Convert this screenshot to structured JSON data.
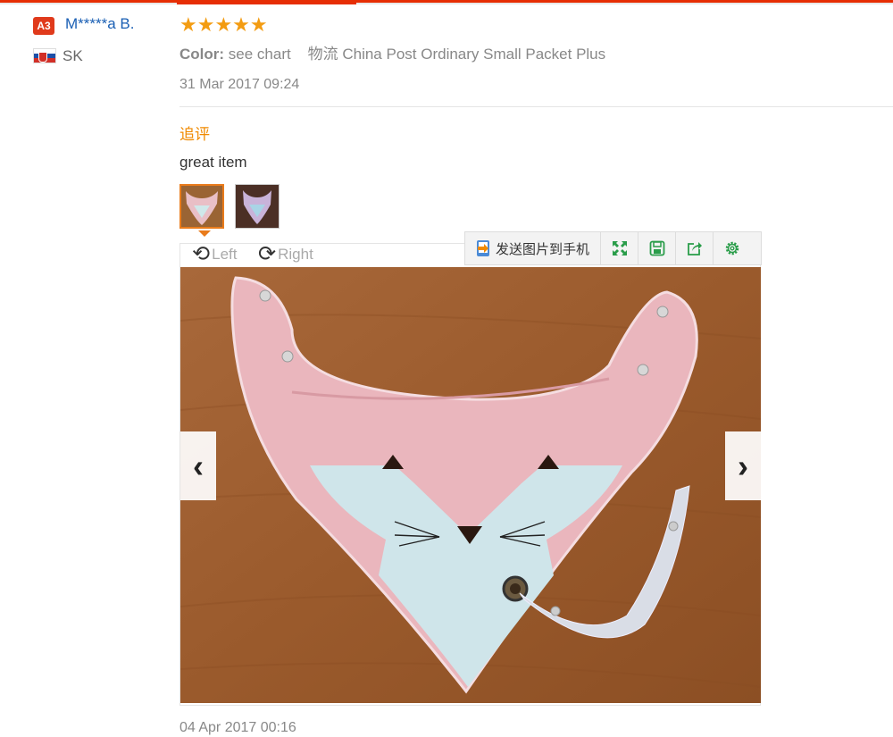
{
  "reviewer": {
    "badge": "A3",
    "name": "M*****a B.",
    "country": "SK"
  },
  "review": {
    "stars": "★★★★★",
    "color_label": "Color:",
    "color_value": "see chart",
    "shipping": "物流 China Post Ordinary Small Packet Plus",
    "date": "31 Mar 2017 09:24",
    "followup_label": "追评",
    "followup_text": "great item",
    "followup_date": "04 Apr 2017 00:16"
  },
  "viewer": {
    "rotate_left": "Left",
    "rotate_right": "Right",
    "send_to_phone": "发送图片到手机",
    "prev": "‹",
    "next": "›"
  },
  "icons": [
    "rotate-left-icon",
    "rotate-right-icon",
    "send-to-phone-icon",
    "fullscreen-icon",
    "save-icon",
    "share-icon",
    "settings-icon"
  ],
  "colors": {
    "accent": "#e62e04",
    "star": "#f39c12",
    "followup": "#f08a00",
    "username": "#1a5fb4",
    "tool_icons": "#2a9d4a"
  }
}
